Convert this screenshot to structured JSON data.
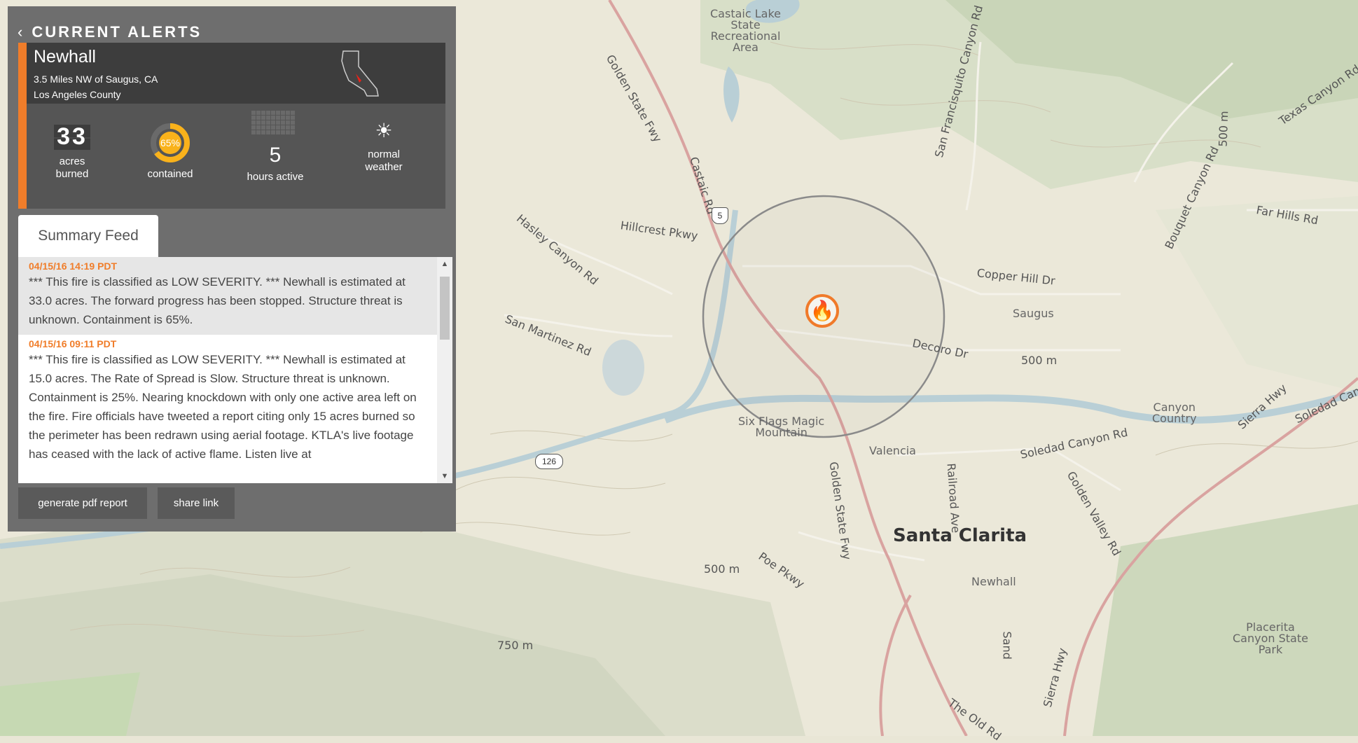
{
  "panel": {
    "header_title": "CURRENT ALERTS",
    "incident": {
      "name": "Newhall",
      "location": "3.5 Miles NW of Saugus, CA",
      "county": "Los Angeles County"
    },
    "stats": {
      "acres_value": "33",
      "acres_label1": "acres",
      "acres_label2": "burned",
      "contained_value": "65%",
      "contained_fraction": 0.65,
      "contained_label": "contained",
      "hours_value": "5",
      "hours_label": "hours active",
      "weather_label1": "normal",
      "weather_label2": "weather",
      "weather_icon": "sun-icon"
    },
    "tab_label": "Summary Feed",
    "feed": [
      {
        "date": "04/15/16 14:19 PDT",
        "text": "*** This fire is classified as LOW SEVERITY. *** Newhall is estimated at 33.0 acres. The forward progress has been stopped. Structure threat is unknown. Containment is 65%."
      },
      {
        "date": "04/15/16 09:11 PDT",
        "text": "*** This fire is classified as LOW SEVERITY. *** Newhall is estimated at 15.0 acres. The Rate of Spread is Slow. Structure threat is unknown. Containment is 25%. Nearing knockdown with only one active area left on the fire. Fire officials have tweeted a report citing only 15 acres burned so the perimeter has been redrawn using aerial footage. KTLA's live footage has ceased with the lack of active flame. Listen live at"
      }
    ],
    "buttons": {
      "pdf": "generate pdf report",
      "share": "share link"
    }
  },
  "map": {
    "labels": {
      "castaic": "Castaic Lake\nState\nRecreational\nArea",
      "golden_state_1": "Golden State Fwy",
      "castaic_rd": "Castaic Rd",
      "sf_canyon": "San Francisquito Canyon Rd",
      "texas_canyon": "Texas Canyon Rd",
      "bouquet": "Bouquet Canyon Rd",
      "far_hills": "Far Hills Rd",
      "hasley": "Hasley Canyon Rd",
      "hillcrest": "Hillcrest Pkwy",
      "copper_hill": "Copper Hill Dr",
      "saugus": "Saugus",
      "decoro": "Decoro Dr",
      "san_martinez": "San Martinez Rd",
      "m500_a": "500 m",
      "m500_b": "500 m",
      "m500_c": "500 m",
      "m750": "750 m",
      "six_flags": "Six Flags Magic\nMountain",
      "valencia": "Valencia",
      "golden_state_2": "Golden State Fwy",
      "railroad": "Railroad Ave",
      "soledad": "Soledad Canyon Rd",
      "canyon_country": "Canyon\nCountry",
      "sierra": "Sierra Hwy",
      "golden_valley": "Golden Valley Rd",
      "santa_clarita": "Santa Clarita",
      "newhall": "Newhall",
      "poe": "Poe Pkwy",
      "placerita": "Placerita\nCanyon State\nPark",
      "old_rd": "The Old Rd",
      "sand": "Sand",
      "sierra2": "Sierra Hwy",
      "soledad2": "Soledad Cany",
      "i5": "5",
      "rt126": "126"
    }
  }
}
